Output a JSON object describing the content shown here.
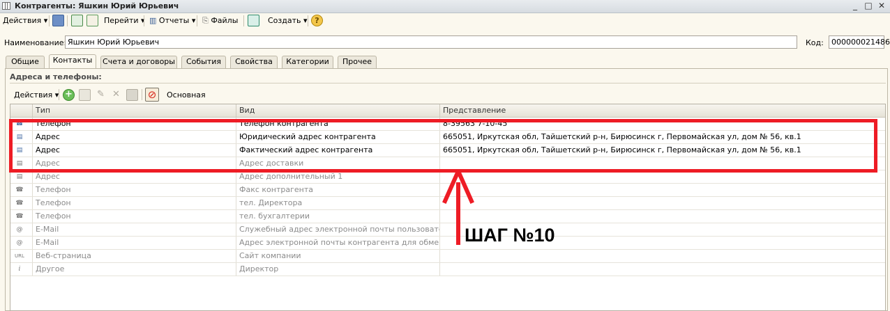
{
  "window": {
    "title": "Контрагенты: Яшкин Юрий Юрьевич",
    "controls": [
      "_",
      "□",
      "✕"
    ]
  },
  "toolbar": {
    "actions": "Действия",
    "goto": "Перейти",
    "reports": "Отчеты",
    "files": "Файлы",
    "create": "Создать",
    "help": "?"
  },
  "form": {
    "name_label": "Наименование:",
    "name_value": "Яшкин Юрий Юрьевич",
    "code_label": "Код:",
    "code_value": "000000021486"
  },
  "tabs": [
    "Общие",
    "Контакты",
    "Счета и договоры",
    "События",
    "Свойства",
    "Категории",
    "Прочее"
  ],
  "active_tab": "Контакты",
  "section": {
    "title": "Адреса и телефоны:",
    "actions": "Действия",
    "main_label": "Основная"
  },
  "grid": {
    "columns": [
      "Тип",
      "Вид",
      "Представление"
    ],
    "rows": [
      {
        "icon": "phone-icon",
        "type": "Телефон",
        "kind": "Телефон контрагента",
        "value": "8-39563 7-10-45",
        "filled": true
      },
      {
        "icon": "address-icon",
        "type": "Адрес",
        "kind": "Юридический адрес контрагента",
        "value": "665051, Иркутская обл, Тайшетский р-н, Бирюсинск г, Первомайская ул, дом № 56, кв.1",
        "filled": true
      },
      {
        "icon": "address-icon",
        "type": "Адрес",
        "kind": "Фактический адрес контрагента",
        "value": "665051, Иркутская обл, Тайшетский р-н, Бирюсинск г, Первомайская ул, дом № 56, кв.1",
        "filled": true
      },
      {
        "icon": "address-icon",
        "type": "Адрес",
        "kind": "Адрес доставки",
        "value": "",
        "filled": false
      },
      {
        "icon": "address-icon",
        "type": "Адрес",
        "kind": "Адрес дополнительный 1",
        "value": "",
        "filled": false
      },
      {
        "icon": "phone-icon",
        "type": "Телефон",
        "kind": "Факс контрагента",
        "value": "",
        "filled": false
      },
      {
        "icon": "phone-icon",
        "type": "Телефон",
        "kind": "тел. Директора",
        "value": "",
        "filled": false
      },
      {
        "icon": "phone-icon",
        "type": "Телефон",
        "kind": "тел. бухгалтерии",
        "value": "",
        "filled": false
      },
      {
        "icon": "email-icon",
        "type": "E-Mail",
        "kind": "Служебный адрес электронной почты пользователя",
        "value": "",
        "filled": false
      },
      {
        "icon": "email-icon",
        "type": "E-Mail",
        "kind": "Адрес электронной почты контрагента для обмена э...",
        "value": "",
        "filled": false
      },
      {
        "icon": "url-icon",
        "type": "Веб-страница",
        "kind": "Сайт компании",
        "value": "",
        "filled": false
      },
      {
        "icon": "info-icon",
        "type": "Другое",
        "kind": "Директор",
        "value": "",
        "filled": false
      }
    ]
  },
  "annotation": {
    "step_text": "ШАГ №10"
  },
  "colors": {
    "highlight": "#ee1c25",
    "background": "#fbf8ee"
  }
}
